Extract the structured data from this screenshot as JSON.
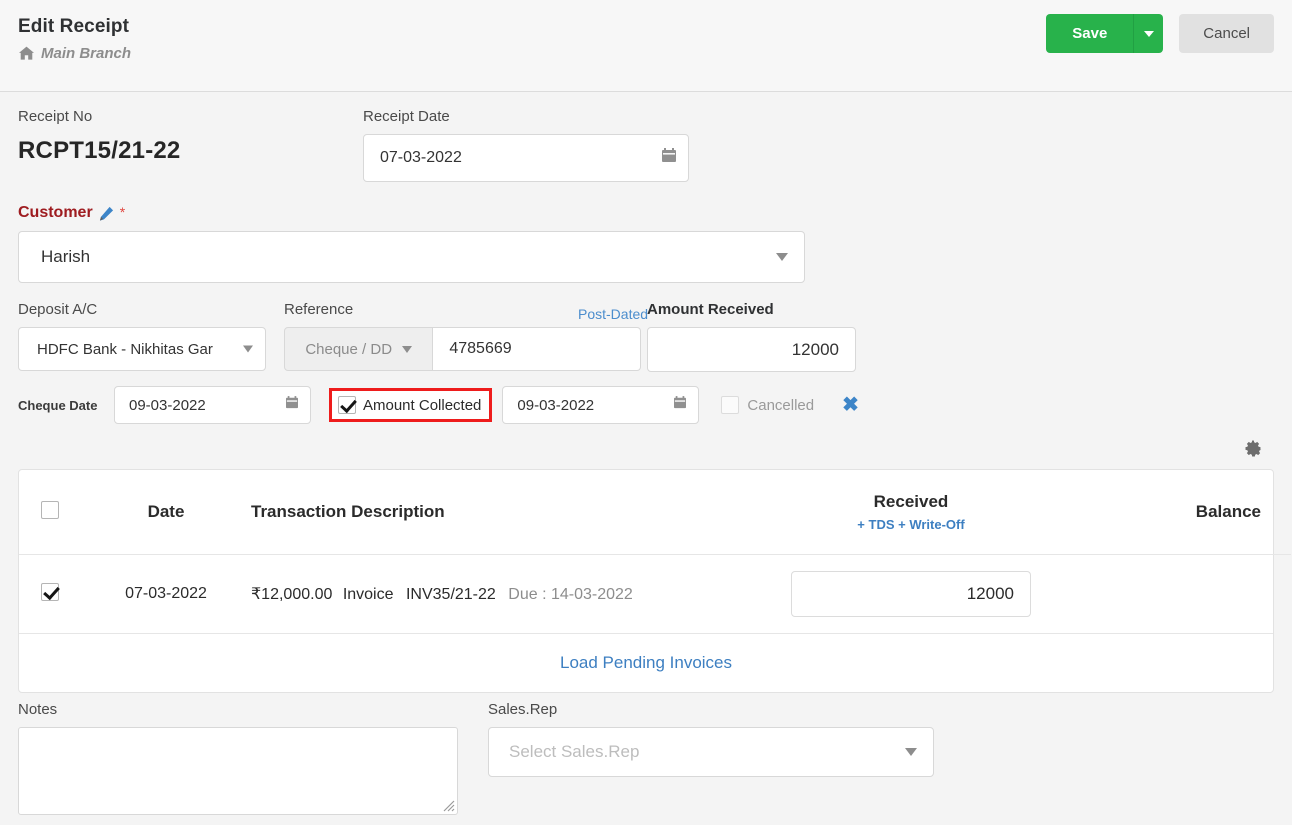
{
  "header": {
    "title": "Edit Receipt",
    "branch": "Main Branch",
    "home_icon": "home-icon",
    "save_label": "Save",
    "cancel_label": "Cancel"
  },
  "receipt": {
    "no_label": "Receipt No",
    "no_value": "RCPT15/21-22",
    "date_label": "Receipt Date",
    "date_value": "07-03-2022",
    "calendar_icon": "calendar-icon"
  },
  "customer": {
    "label": "Customer",
    "edit_icon": "pencil-icon",
    "required_mark": "*",
    "value": "Harish"
  },
  "deposit": {
    "label": "Deposit A/C",
    "value": "HDFC Bank - Nikhitas Gar"
  },
  "reference": {
    "label": "Reference",
    "type_value": "Cheque / DD",
    "number_value": "4785669",
    "post_dated_link": "Post-Dated"
  },
  "amount": {
    "label": "Amount Received",
    "value": "12000"
  },
  "cheque": {
    "date_label": "Cheque Date",
    "date_value": "09-03-2022",
    "collected_label": "Amount Collected",
    "collected_checked": true,
    "collected_date_value": "09-03-2022",
    "cancelled_label": "Cancelled",
    "cancelled_checked": false,
    "remove_icon": "x-remove-icon"
  },
  "settings_icon": "gear-icon",
  "table": {
    "columns": {
      "date": "Date",
      "description": "Transaction Description",
      "received": "Received",
      "received_sub_link": "+ TDS + Write-Off",
      "balance": "Balance"
    },
    "rows": [
      {
        "checked": true,
        "date": "07-03-2022",
        "amount": "₹12,000.00",
        "doc_type": "Invoice",
        "doc_no": "INV35/21-22",
        "due": "Due : 14-03-2022",
        "received": "12000",
        "balance": ""
      }
    ],
    "footer_link": "Load Pending Invoices"
  },
  "notes": {
    "label": "Notes",
    "value": ""
  },
  "sales_rep": {
    "label": "Sales.Rep",
    "placeholder": "Select Sales.Rep"
  },
  "colors": {
    "save_green": "#28b24b",
    "link_blue": "#3d7fc1",
    "customer_red": "#9e1c20",
    "highlight_red": "#ee1c1c"
  }
}
